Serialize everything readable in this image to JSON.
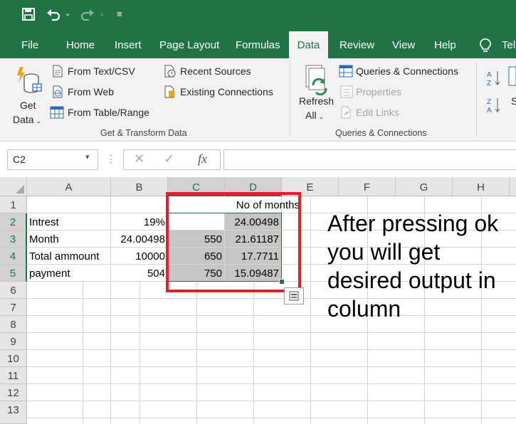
{
  "ribbon_tabs": [
    "File",
    "Home",
    "Insert",
    "Page Layout",
    "Formulas",
    "Data",
    "Review",
    "View",
    "Help",
    "Tel"
  ],
  "active_tab": "Data",
  "get_transform": {
    "get_data": [
      "Get",
      "Data"
    ],
    "from_text_csv": "From Text/CSV",
    "from_web": "From Web",
    "from_table_range": "From Table/Range",
    "recent_sources": "Recent Sources",
    "existing_connections": "Existing Connections",
    "group_label": "Get & Transform Data"
  },
  "queries": {
    "refresh": [
      "Refresh",
      "All"
    ],
    "queries_connections": "Queries & Connections",
    "properties": "Properties",
    "edit_links": "Edit Links",
    "group_label": "Queries & Connections"
  },
  "sort_partial": "S",
  "formula_bar": {
    "name_box": "C2",
    "fx": "fx",
    "formula": ""
  },
  "columns": [
    "A",
    "B",
    "C",
    "D",
    "E",
    "F",
    "G",
    "H"
  ],
  "rows": [
    "1",
    "2",
    "3",
    "4",
    "5",
    "6",
    "7",
    "8",
    "9",
    "10",
    "11",
    "12",
    "13"
  ],
  "cells": {
    "D1": "No of months",
    "A2": "Intrest",
    "B2": "19%",
    "D2": "24.00498",
    "A3": "Month",
    "B3": "24.00498",
    "C3": "550",
    "D3": "21.61187",
    "A4": "Total ammount",
    "B4": "10000",
    "C4": "650",
    "D4": "17.7711",
    "A5": "payment",
    "B5": "504",
    "C5": "750",
    "D5": "15.09487"
  },
  "annotation": "After pressing ok you will get desired output in column",
  "colors": {
    "excel_green": "#217346",
    "highlight_red": "#e0202a",
    "selection_fill": "#c6c6c6"
  }
}
